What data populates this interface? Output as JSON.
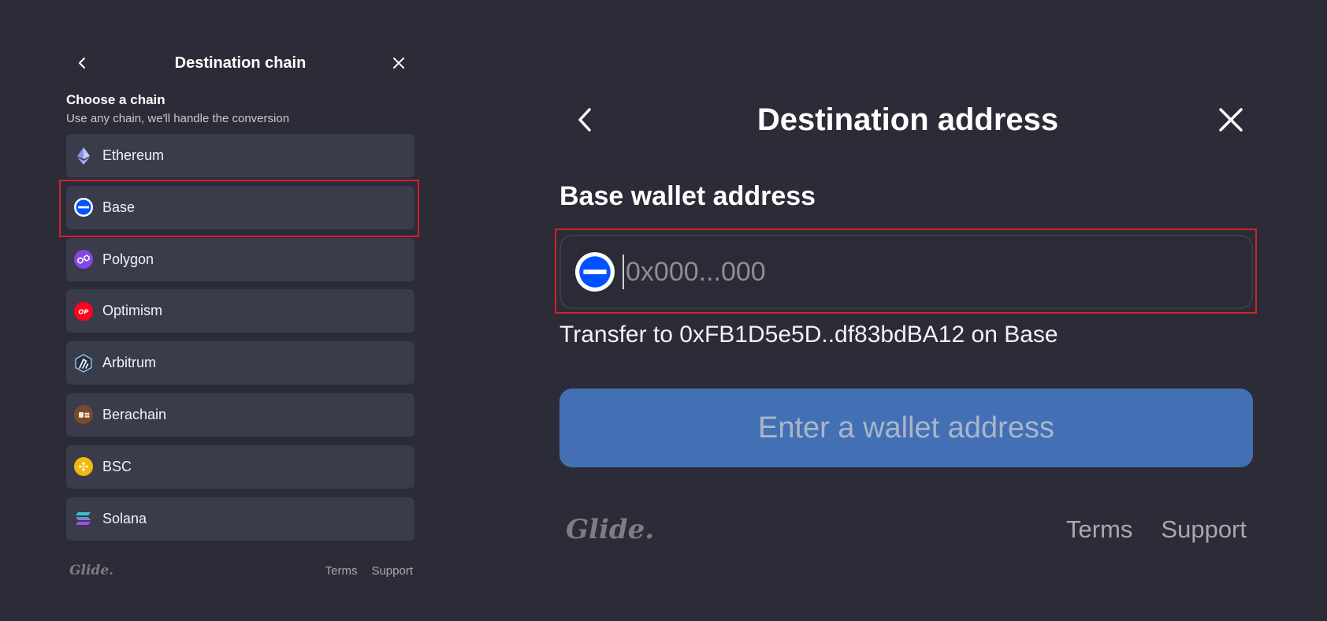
{
  "left_panel": {
    "title": "Destination chain",
    "section_title": "Choose a chain",
    "section_subtitle": "Use any chain, we'll handle the conversion",
    "chains": [
      {
        "label": "Ethereum",
        "icon": "ethereum-icon"
      },
      {
        "label": "Base",
        "icon": "base-icon"
      },
      {
        "label": "Polygon",
        "icon": "polygon-icon"
      },
      {
        "label": "Optimism",
        "icon": "optimism-icon"
      },
      {
        "label": "Arbitrum",
        "icon": "arbitrum-icon"
      },
      {
        "label": "Berachain",
        "icon": "berachain-icon"
      },
      {
        "label": "BSC",
        "icon": "bsc-icon"
      },
      {
        "label": "Solana",
        "icon": "solana-icon"
      }
    ],
    "selected_chain": "Base",
    "footer": {
      "logo": "Glide.",
      "terms": "Terms",
      "support": "Support"
    }
  },
  "right_panel": {
    "title": "Destination address",
    "field_label": "Base wallet address",
    "input": {
      "value": "",
      "placeholder": "0x000...000"
    },
    "transfer_text": "Transfer to 0xFB1D5e5D..df83bdBA12 on Base",
    "submit_label": "Enter a wallet address",
    "footer": {
      "logo": "Glide.",
      "terms": "Terms",
      "support": "Support"
    }
  },
  "colors": {
    "background": "#2a2b36",
    "list_item": "#3a3b4b",
    "highlight": "#d0222a",
    "primary_button": "#4370b5",
    "base_blue": "#0052ff",
    "polygon_purple": "#8247e5",
    "optimism_red": "#ff0420",
    "bsc_yellow": "#f0b90b"
  }
}
